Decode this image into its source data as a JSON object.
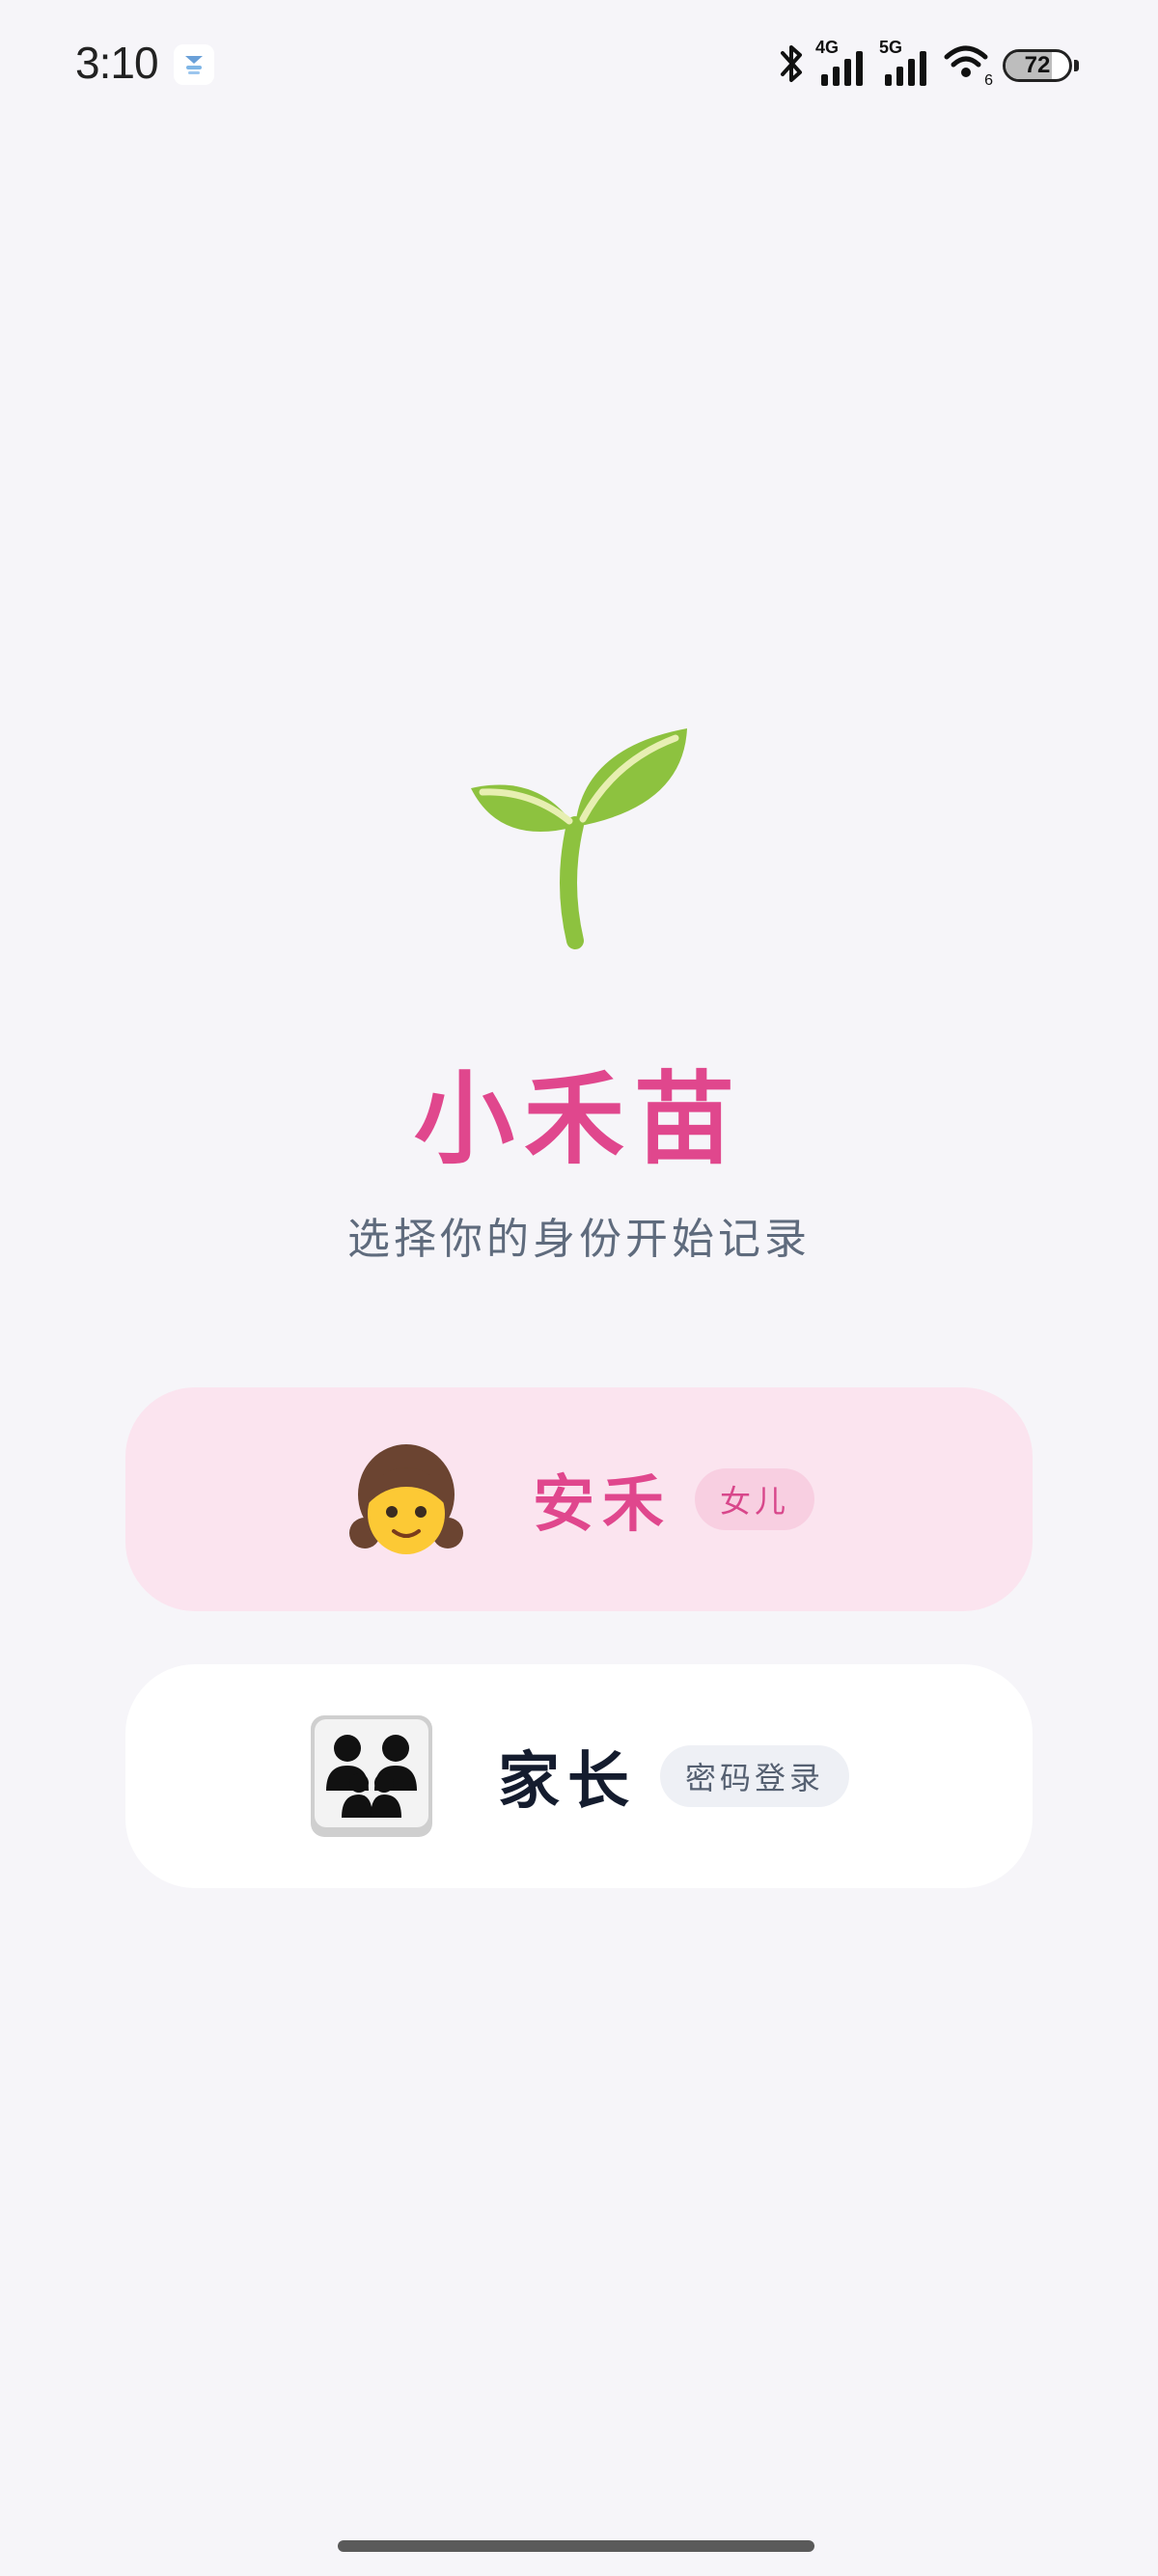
{
  "status_bar": {
    "time": "3:10",
    "network_1": "4G",
    "network_2": "5G",
    "wifi_sub": "6",
    "battery_level": "72",
    "battery_fraction": 0.72
  },
  "app": {
    "title": "小禾苗",
    "subtitle": "选择你的身份开始记录",
    "brand_color": "#e0478d"
  },
  "profiles": [
    {
      "name": "安禾",
      "tag": "女儿",
      "icon": "girl-icon"
    },
    {
      "name": "家长",
      "tag": "密码登录",
      "icon": "family-icon"
    }
  ]
}
